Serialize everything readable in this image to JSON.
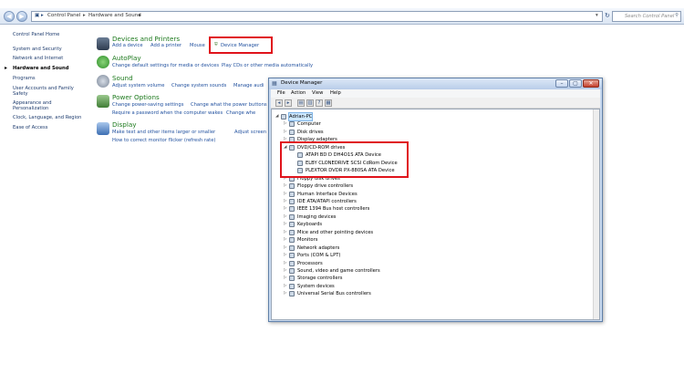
{
  "address_bar": {
    "crumbs": [
      "Control Panel",
      "Hardware and Sound"
    ],
    "search_placeholder": "Search Control Panel"
  },
  "left_nav": {
    "home": "Control Panel Home",
    "items": [
      "System and Security",
      "Network and Internet",
      "Hardware and Sound",
      "Programs",
      "User Accounts and Family",
      "Safety",
      "Appearance and",
      "Personalization",
      "Clock, Language, and Region",
      "Ease of Access"
    ]
  },
  "categories": [
    {
      "title": "Devices and Printers",
      "links": [
        "Add a device",
        "Add a printer",
        "Mouse",
        "Device Manager"
      ]
    },
    {
      "title": "AutoPlay",
      "links": [
        "Change default settings for media or devices",
        "Play CDs or other media automatically"
      ]
    },
    {
      "title": "Sound",
      "links": [
        "Adjust system volume",
        "Change system sounds",
        "Manage audi"
      ]
    },
    {
      "title": "Power Options",
      "links": [
        "Change power-saving settings",
        "Change what the power buttons do",
        "Require a password when the computer wakes",
        "Change whe"
      ]
    },
    {
      "title": "Display",
      "links": [
        "Make text and other items larger or smaller",
        "Adjust screen resolutio",
        "How to correct monitor flicker (refresh rate)"
      ]
    }
  ],
  "device_manager": {
    "title": "Device Manager",
    "menu": [
      "File",
      "Action",
      "View",
      "Help"
    ],
    "root": "Adrian-PC",
    "dvd_category": "DVD/CD-ROM drives",
    "dvd_devices": [
      "ATAPI BD  D  DH4O1S ATA Device",
      "ELBY CLONEDRIVE SCSI CdRom Device",
      "PLEXTOR DVDR   PX-880SA ATA Device"
    ],
    "pre_categories": [
      "Computer",
      "Disk drives",
      "Display adapters"
    ],
    "post_categories": [
      "Floppy disk drives",
      "Floppy drive controllers",
      "Human Interface Devices",
      "IDE ATA/ATAPI controllers",
      "IEEE 1394 Bus host controllers",
      "Imaging devices",
      "Keyboards",
      "Mice and other pointing devices",
      "Monitors",
      "Network adapters",
      "Ports (COM & LPT)",
      "Processors",
      "Sound, video and game controllers",
      "Storage controllers",
      "System devices",
      "Universal Serial Bus controllers"
    ]
  },
  "colors": {
    "highlight": "#e0131b",
    "category_title": "#1e7a1e",
    "link": "#1f4f9e"
  }
}
